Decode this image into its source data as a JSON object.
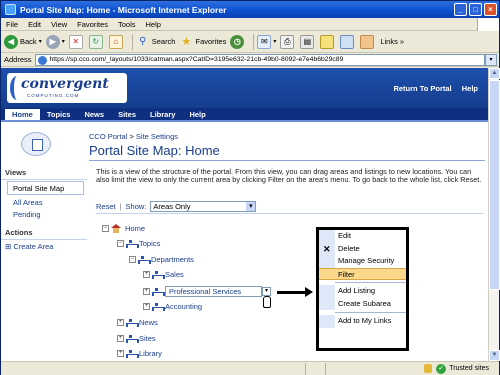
{
  "window": {
    "title": "Portal Site Map: Home - Microsoft Internet Explorer"
  },
  "menu": [
    "File",
    "Edit",
    "View",
    "Favorites",
    "Tools",
    "Help"
  ],
  "toolbar": {
    "back_label": "Back",
    "search_label": "Search",
    "favorites_label": "Favorites",
    "links_label": "Links"
  },
  "address": {
    "label": "Address",
    "url": "https://sp.cco.com/_layouts/1033/catman.aspx?CatID=3195e632-21cb-49b0-8092-e7e4b6b29c89"
  },
  "banner": {
    "logo_text": "convergent",
    "logo_sub": "COMPUTING.COM",
    "links": [
      "Return To Portal",
      "Help"
    ]
  },
  "nav": {
    "items": [
      "Home",
      "Topics",
      "News",
      "Sites",
      "Library",
      "Help"
    ]
  },
  "page": {
    "breadcrumb_root": "CCO Portal",
    "breadcrumb_sep": ">",
    "breadcrumb_current": "Site Settings",
    "title": "Portal Site Map: Home",
    "description": "This is a view of the structure of the portal. From this view, you can drag areas and listings to new locations. You can also limit the view to only the current area by clicking Filter on the area's menu. To go back to the whole list, click Reset.",
    "reset_label": "Reset",
    "show_label": "Show:",
    "show_value": "Areas Only"
  },
  "leftnav": {
    "views_heading": "Views",
    "views": [
      "Portal Site Map",
      "All Areas",
      "Pending"
    ],
    "actions_heading": "Actions",
    "actions": [
      "Create Area"
    ]
  },
  "tree": {
    "home": "Home",
    "topics": "Topics",
    "departments": "Departments",
    "sales": "Sales",
    "professional_services": "Professional Services",
    "accounting": "Accounting",
    "news": "News",
    "sites": "Sites",
    "library": "Library"
  },
  "context_menu": {
    "items": [
      "Edit",
      "Delete",
      "Manage Security",
      "Filter",
      "Add Listing",
      "Create Subarea",
      "Add to My Links"
    ],
    "highlighted": "Filter"
  },
  "status": {
    "zone": "Trusted sites"
  }
}
